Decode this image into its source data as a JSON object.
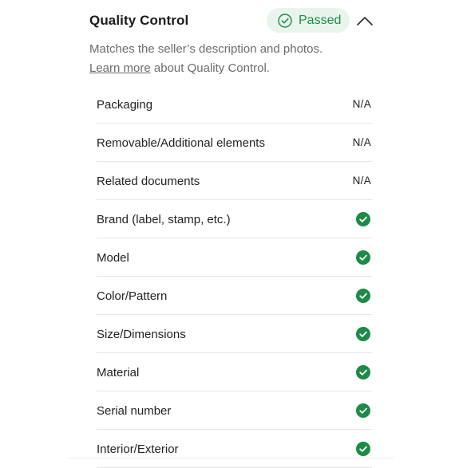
{
  "section": {
    "title": "Quality Control",
    "status": "Passed",
    "status_color": "#1d8a47",
    "status_bg": "#e9f5ec",
    "toggle_icon": "chevron-up-icon",
    "description_line1": "Matches the seller’s description and photos.",
    "learn_more_label": "Learn more",
    "description_suffix": " about Quality Control."
  },
  "checklist": [
    {
      "label": "Packaging",
      "result": "N/A"
    },
    {
      "label": "Removable/Additional elements",
      "result": "N/A"
    },
    {
      "label": "Related documents",
      "result": "N/A"
    },
    {
      "label": "Brand (label, stamp, etc.)",
      "result": "check",
      "icon": "check-circle-icon"
    },
    {
      "label": "Model",
      "result": "check",
      "icon": "check-circle-icon"
    },
    {
      "label": "Color/Pattern",
      "result": "check",
      "icon": "check-circle-icon"
    },
    {
      "label": "Size/Dimensions",
      "result": "check",
      "icon": "check-circle-icon"
    },
    {
      "label": "Material",
      "result": "check",
      "icon": "check-circle-icon"
    },
    {
      "label": "Serial number",
      "result": "check",
      "icon": "check-circle-icon"
    },
    {
      "label": "Interior/Exterior",
      "result": "check",
      "icon": "check-circle-icon"
    }
  ],
  "colors": {
    "check_green": "#1d8a47",
    "divider": "#e6e6e6",
    "muted_text": "#6c6c6c"
  }
}
